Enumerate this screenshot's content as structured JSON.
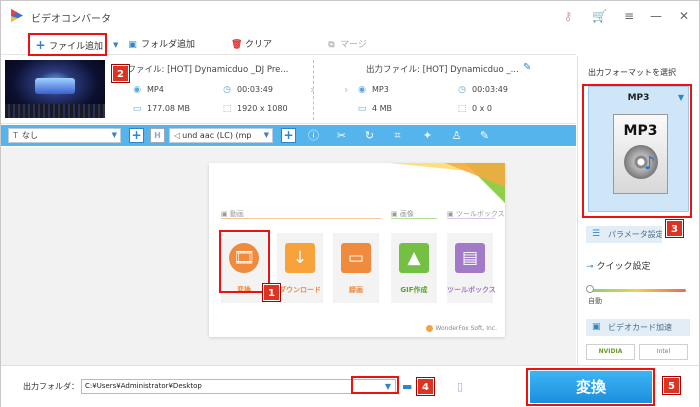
{
  "app": {
    "title": "ビデオコンバータ"
  },
  "toolbar": {
    "add_file": "ファイル追加",
    "add_folder": "フォルダ追加",
    "clear": "クリア",
    "merge": "マージ"
  },
  "file": {
    "source_label": "元ファイル: [HOT] Dynamicduo _DJ Pre...",
    "source_format": "MP4",
    "source_duration": "00:03:49",
    "source_size": "177.08 MB",
    "source_resolution": "1920 x 1080",
    "output_label": "出力ファイル: [HOT] Dynamicduo _...",
    "output_format": "MP3",
    "output_duration": "00:03:49",
    "output_size": "4 MB",
    "output_resolution": "0 x 0"
  },
  "edit_bar": {
    "subtitle_value": "なし",
    "audio_value": "und aac (LC) (mp"
  },
  "launcher": {
    "sections": {
      "video": "動画",
      "image": "画像",
      "toolbox": "ツールボックス"
    },
    "tiles": [
      {
        "label": "変換",
        "color": "#f08a3c",
        "text_color": "#f08a3c"
      },
      {
        "label": "ダウンロード",
        "color": "#f7a23b",
        "text_color": "#f08a3c"
      },
      {
        "label": "録画",
        "color": "#f08a3c",
        "text_color": "#f08a3c"
      },
      {
        "label": "GIF作成",
        "color": "#74c043",
        "text_color": "#5aa32c"
      },
      {
        "label": "ツールボックス",
        "color": "#a27ac8",
        "text_color": "#a27ac8"
      }
    ],
    "brand": "WonderFox Soft, Inc."
  },
  "right_panel": {
    "title": "出力フォーマットを選択",
    "format": "MP3",
    "format_icon_label": "MP3",
    "params_button": "パラメータ設定",
    "quick_settings": "クイック設定",
    "slider_label": "自動",
    "slider_value": 0,
    "video_card_accel": "ビデオカード加速",
    "gpu_nvidia": "NVIDIA",
    "gpu_intel": "Intel"
  },
  "bottom": {
    "output_folder_label": "出力フォルダ：",
    "output_folder_value": "C:¥Users¥Administrator¥Desktop",
    "convert_button": "変換"
  },
  "annotations": [
    "1",
    "2",
    "3",
    "4",
    "5"
  ],
  "colors": {
    "accent_blue": "#55b4ec",
    "highlight_red": "#e11111",
    "convert_blue": "#1d8fdd"
  }
}
